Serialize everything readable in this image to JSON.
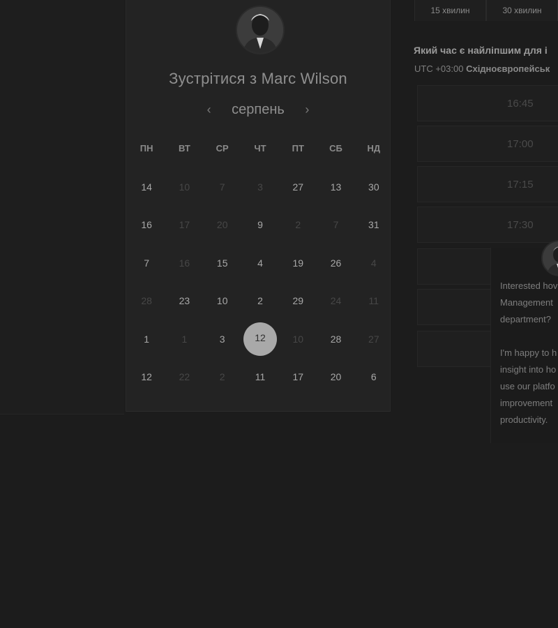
{
  "scheduler": {
    "title": "Зустрітися з Marc Wilson",
    "month": "серпень",
    "prev_icon": "chevron-left-icon",
    "next_icon": "chevron-right-icon",
    "weekdays": [
      "ПН",
      "ВТ",
      "СР",
      "ЧТ",
      "ПТ",
      "СБ",
      "НД"
    ],
    "weeks": [
      [
        {
          "d": "14",
          "dim": false
        },
        {
          "d": "10",
          "dim": true
        },
        {
          "d": "7",
          "dim": true
        },
        {
          "d": "3",
          "dim": true
        },
        {
          "d": "27",
          "dim": false
        },
        {
          "d": "13",
          "dim": false
        },
        {
          "d": "30",
          "dim": false
        }
      ],
      [
        {
          "d": "16",
          "dim": false
        },
        {
          "d": "17",
          "dim": true
        },
        {
          "d": "20",
          "dim": true
        },
        {
          "d": "9",
          "dim": false
        },
        {
          "d": "2",
          "dim": true
        },
        {
          "d": "7",
          "dim": true
        },
        {
          "d": "31",
          "dim": false
        }
      ],
      [
        {
          "d": "7",
          "dim": false
        },
        {
          "d": "16",
          "dim": true
        },
        {
          "d": "15",
          "dim": false
        },
        {
          "d": "4",
          "dim": false
        },
        {
          "d": "19",
          "dim": false
        },
        {
          "d": "26",
          "dim": false
        },
        {
          "d": "4",
          "dim": true
        }
      ],
      [
        {
          "d": "28",
          "dim": true
        },
        {
          "d": "23",
          "dim": false
        },
        {
          "d": "10",
          "dim": false
        },
        {
          "d": "2",
          "dim": false
        },
        {
          "d": "29",
          "dim": false
        },
        {
          "d": "24",
          "dim": true
        },
        {
          "d": "11",
          "dim": true
        }
      ],
      [
        {
          "d": "1",
          "dim": false
        },
        {
          "d": "1",
          "dim": true
        },
        {
          "d": "3",
          "dim": false
        },
        {
          "d": "12",
          "dim": false,
          "selected": true
        },
        {
          "d": "10",
          "dim": true
        },
        {
          "d": "28",
          "dim": false
        },
        {
          "d": "27",
          "dim": true
        }
      ],
      [
        {
          "d": "12",
          "dim": false
        },
        {
          "d": "22",
          "dim": true
        },
        {
          "d": "2",
          "dim": true
        },
        {
          "d": "11",
          "dim": false
        },
        {
          "d": "17",
          "dim": false
        },
        {
          "d": "20",
          "dim": false
        },
        {
          "d": "6",
          "dim": false
        }
      ]
    ]
  },
  "durations": [
    "15 хвилин",
    "30 хвилин"
  ],
  "time_panel": {
    "question": "Який час є найліпшим для і",
    "tz_prefix": "UTC +03:00",
    "tz_name": "Східноєвропейськ",
    "slots": [
      "16:45",
      "17:00",
      "17:15",
      "17:30"
    ]
  },
  "chat": {
    "lines1": [
      "Interested hov",
      "Management",
      "department?"
    ],
    "lines2": [
      "I'm happy to h",
      "insight into ho",
      "use our platfo",
      "improvement",
      "productivity."
    ]
  }
}
